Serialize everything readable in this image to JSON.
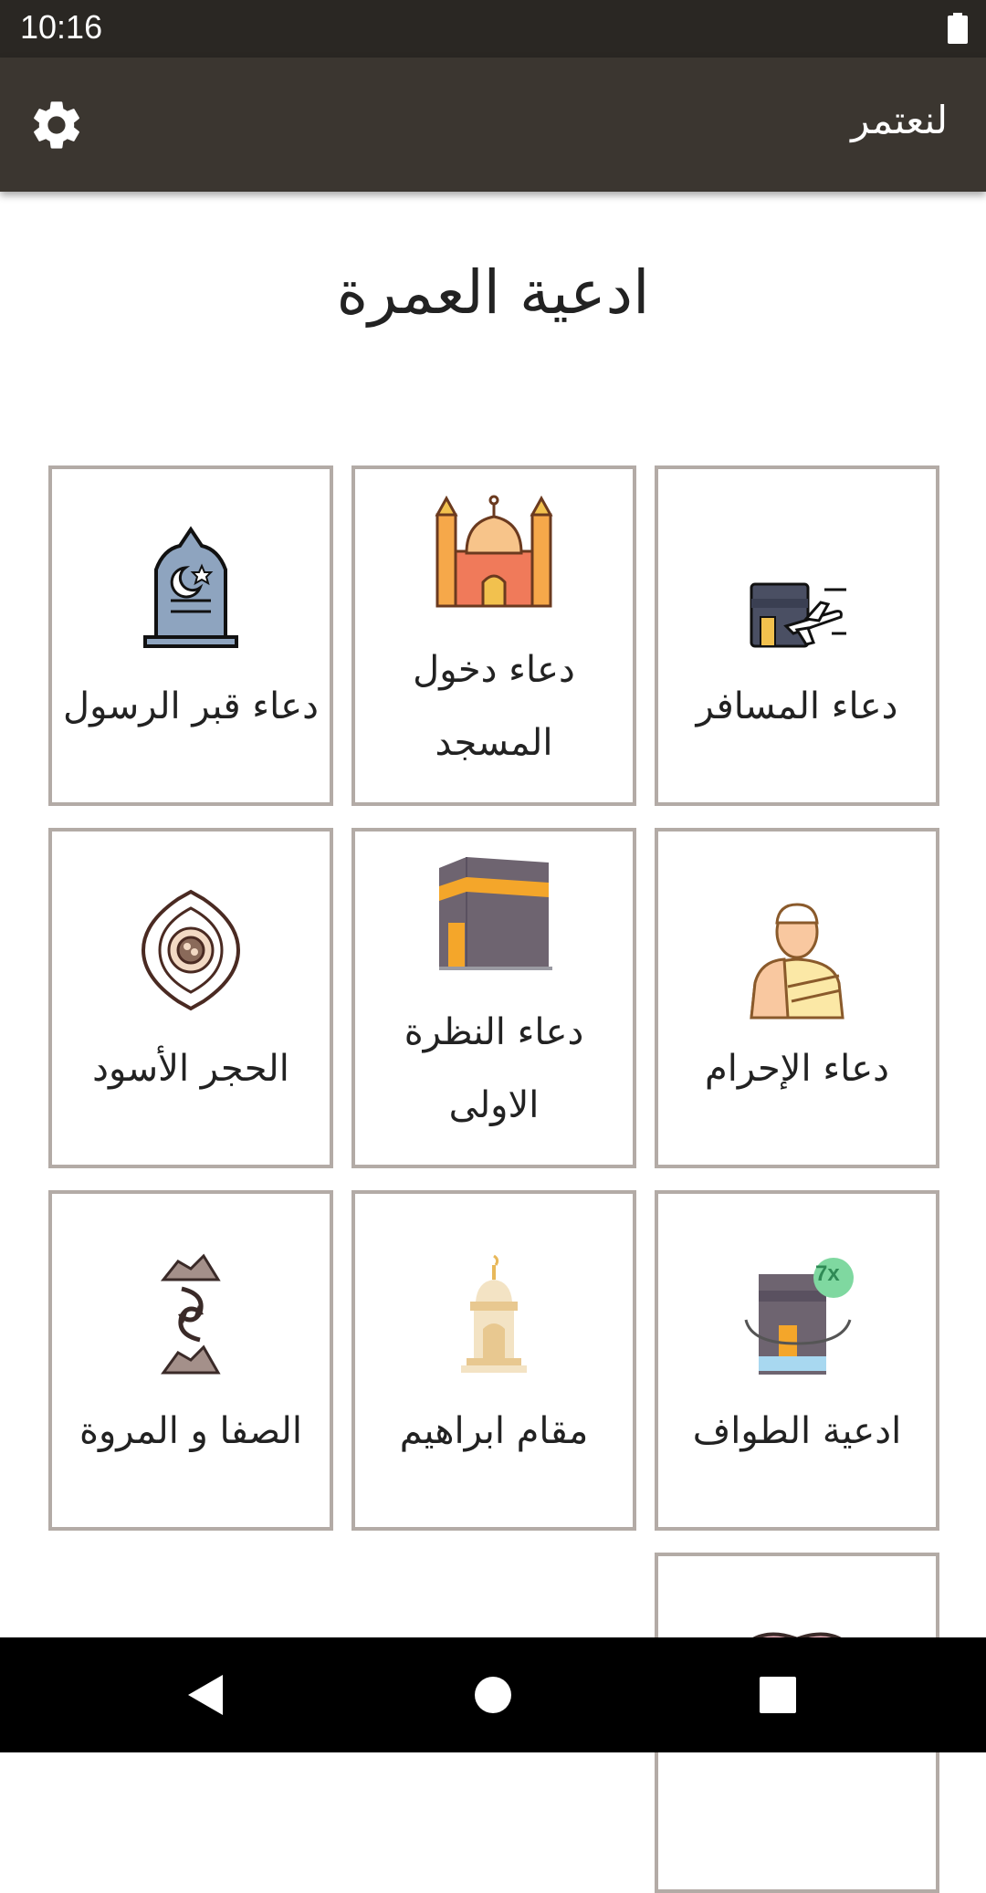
{
  "status_bar": {
    "time": "10:16",
    "battery_icon": "battery-full-icon"
  },
  "app_bar": {
    "title": "لنعتمر",
    "settings_icon": "gear-icon"
  },
  "page_title": "ادعية العمرة",
  "cards": [
    {
      "label": "دعاء المسافر",
      "icon": "kaaba-airplane-icon"
    },
    {
      "label": "دعاء دخول المسجد",
      "icon": "mosque-icon"
    },
    {
      "label": "دعاء قبر الرسول",
      "icon": "tombstone-icon"
    },
    {
      "label": "دعاء الإحرام",
      "icon": "pilgrim-ihram-icon"
    },
    {
      "label": "دعاء النظرة الاولى",
      "icon": "kaaba-icon"
    },
    {
      "label": "الحجر الأسود",
      "icon": "black-stone-icon"
    },
    {
      "label": "ادعية الطواف",
      "icon": "tawaf-7x-icon"
    },
    {
      "label": "مقام ابراهيم",
      "icon": "maqam-ibrahim-icon"
    },
    {
      "label": "الصفا و المروة",
      "icon": "safa-marwa-icon"
    },
    {
      "label": "",
      "icon": "book-icon"
    }
  ],
  "tawaf_badge": "7x",
  "nav_bar": {
    "back_icon": "back-triangle-icon",
    "home_icon": "home-circle-icon",
    "recents_icon": "recents-square-icon"
  },
  "colors": {
    "app_bar": "#3b3630",
    "status_bar": "#2a2723",
    "card_border": "#b3aba6"
  }
}
